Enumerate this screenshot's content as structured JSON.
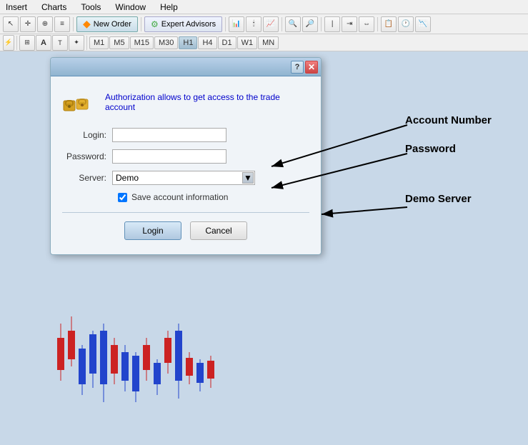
{
  "menu": {
    "items": [
      "Insert",
      "Charts",
      "Tools",
      "Window",
      "Help"
    ]
  },
  "toolbar1": {
    "new_order_label": "New Order",
    "expert_advisors_label": "Expert Advisors"
  },
  "toolbar2": {
    "timeframes": [
      "M1",
      "M5",
      "M15",
      "M30",
      "H1",
      "H4",
      "D1",
      "W1",
      "MN"
    ]
  },
  "dialog": {
    "description": "Authorization allows to get access to the trade account",
    "fields": {
      "login_label": "Login:",
      "password_label": "Password:",
      "server_label": "Server:",
      "server_value": "Demo"
    },
    "checkbox_label": "Save account information",
    "buttons": {
      "login": "Login",
      "cancel": "Cancel"
    }
  },
  "annotations": {
    "account_number": "Account Number",
    "password": "Password",
    "demo_server": "Demo Server"
  }
}
